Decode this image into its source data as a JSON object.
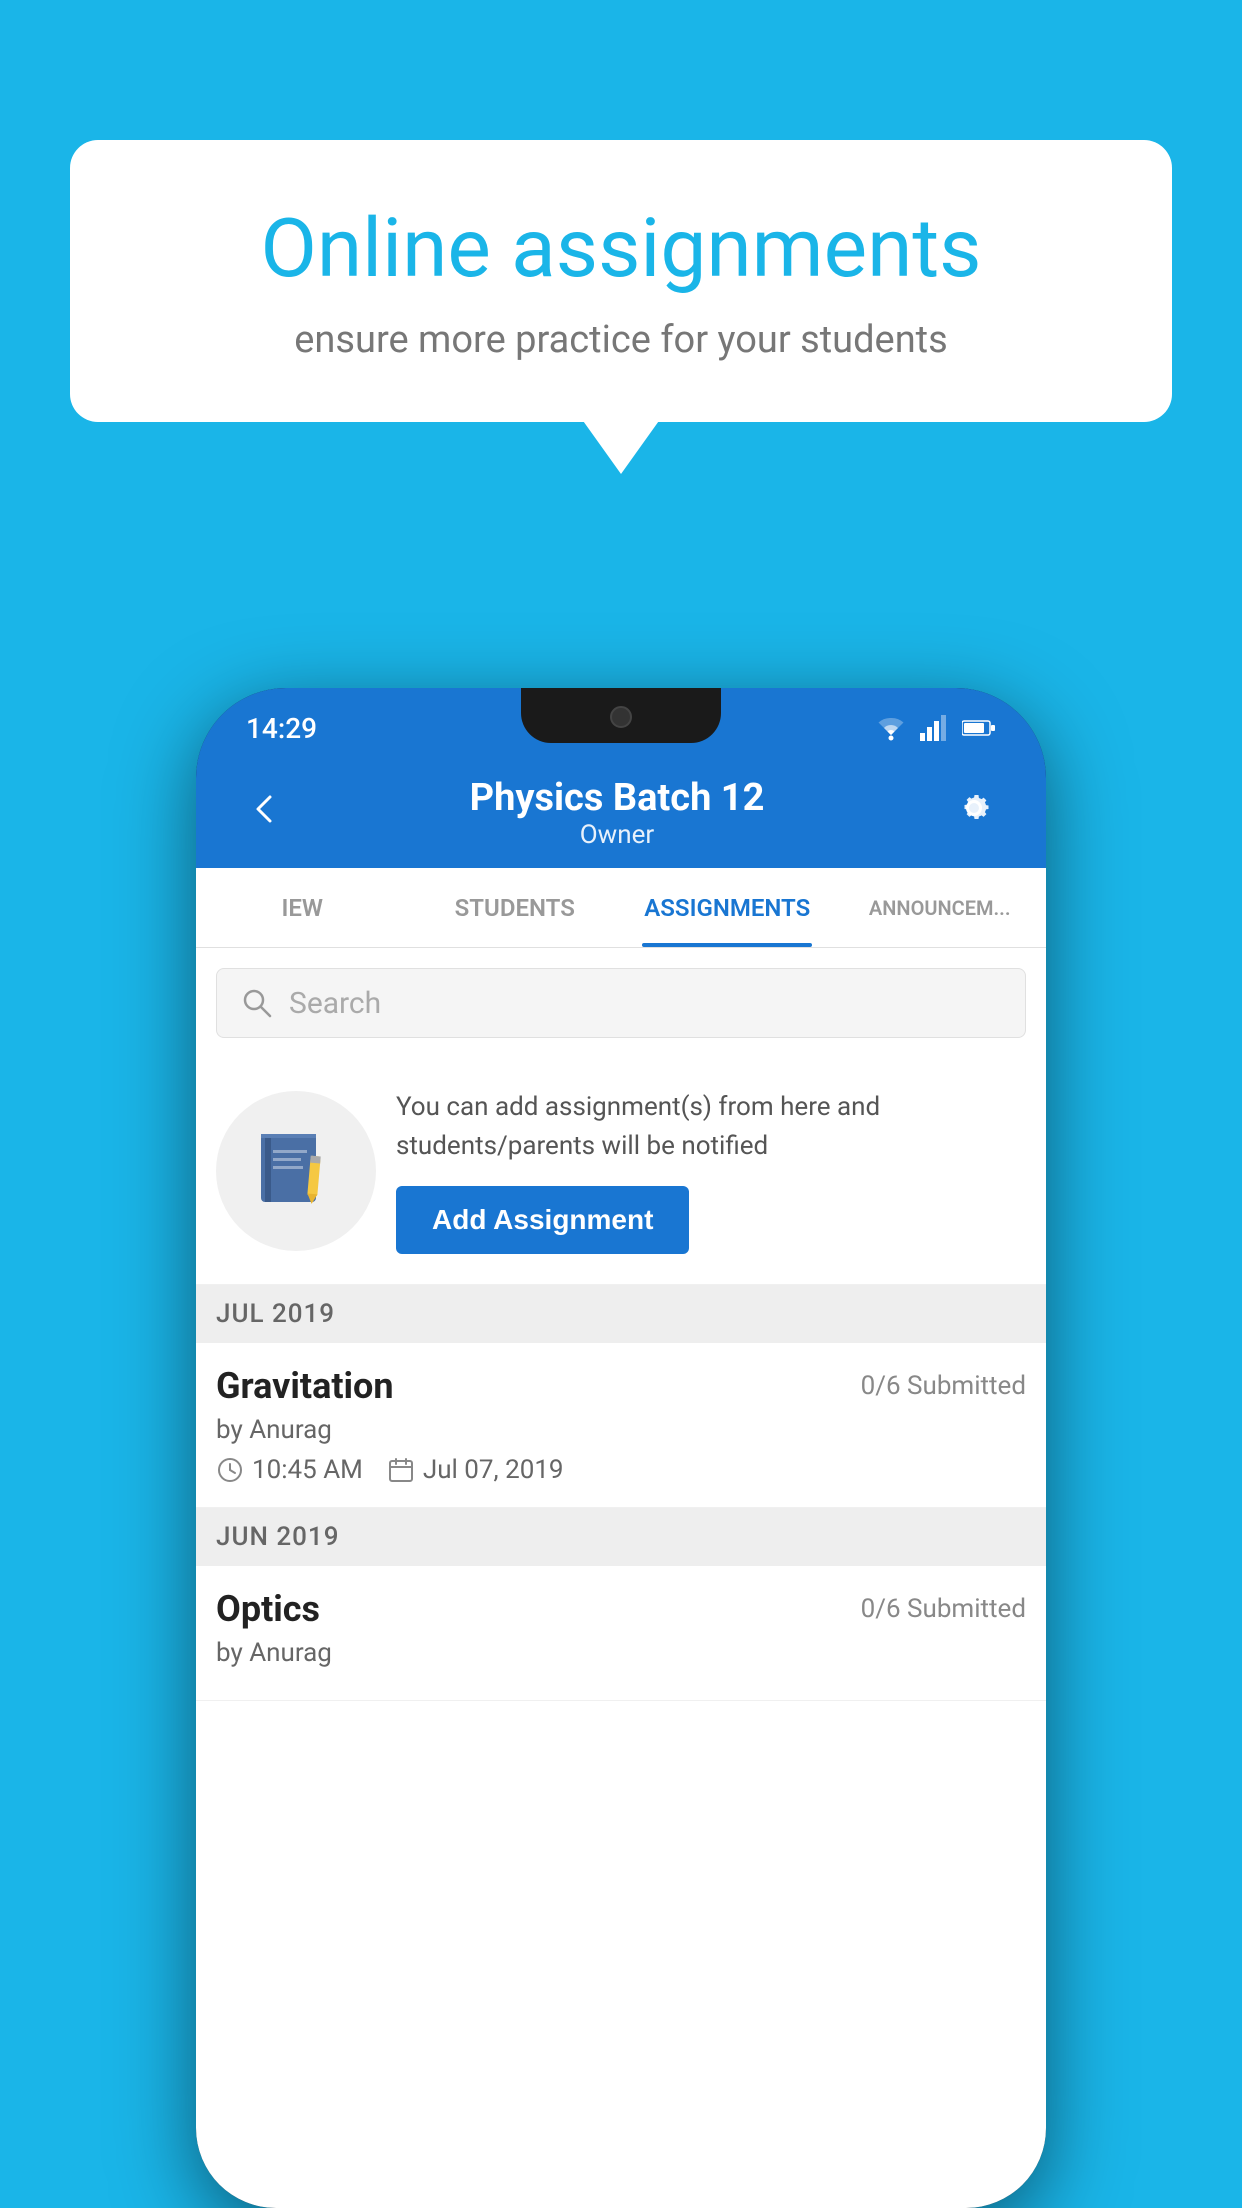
{
  "background_color": "#1ab5e8",
  "speech_bubble": {
    "title": "Online assignments",
    "subtitle": "ensure more practice for your students"
  },
  "status_bar": {
    "time": "14:29",
    "wifi": "▲",
    "signal": "▲",
    "battery": "▮"
  },
  "app_bar": {
    "title": "Physics Batch 12",
    "subtitle": "Owner",
    "back_label": "←",
    "settings_label": "⚙"
  },
  "tabs": [
    {
      "label": "IEW",
      "active": false
    },
    {
      "label": "STUDENTS",
      "active": false
    },
    {
      "label": "ASSIGNMENTS",
      "active": true
    },
    {
      "label": "ANNOUNCEM...",
      "active": false
    }
  ],
  "search": {
    "placeholder": "Search"
  },
  "promo": {
    "description": "You can add assignment(s) from here and students/parents will be notified",
    "button_label": "Add Assignment"
  },
  "sections": [
    {
      "month": "JUL 2019",
      "assignments": [
        {
          "name": "Gravitation",
          "submitted": "0/6 Submitted",
          "author": "by Anurag",
          "time": "10:45 AM",
          "date": "Jul 07, 2019"
        }
      ]
    },
    {
      "month": "JUN 2019",
      "assignments": [
        {
          "name": "Optics",
          "submitted": "0/6 Submitted",
          "author": "by Anurag",
          "time": "",
          "date": ""
        }
      ]
    }
  ]
}
